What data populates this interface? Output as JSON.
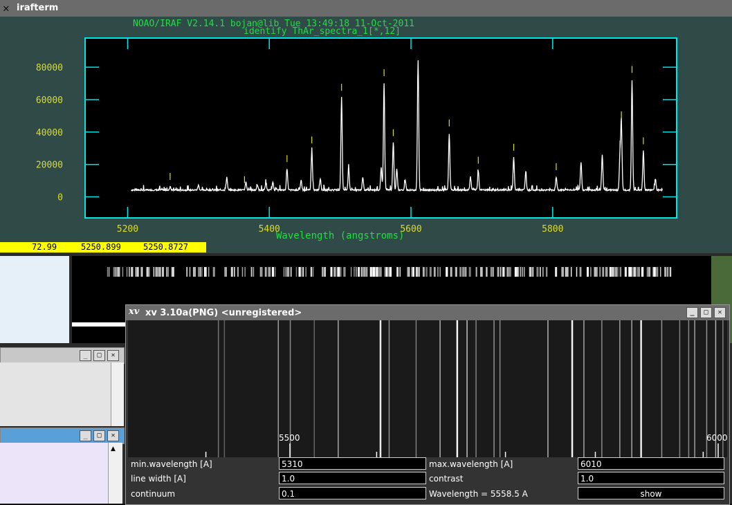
{
  "iraf_window": {
    "title": "irafterm",
    "header_line1": "NOAO/IRAF V2.14.1 bojan@lib Tue 13:49:18 11-Oct-2011",
    "header_line2": "identify ThAr_spectra_1[*,12]",
    "xlabel": "Wavelength (angstroms)",
    "status": {
      "v1": "72.99",
      "v2": "5250.899",
      "v3": "5250.8727"
    }
  },
  "chart_data": {
    "type": "line",
    "title": "",
    "xlabel": "Wavelength (angstroms)",
    "ylabel": "",
    "xlim": [
      5140,
      5975
    ],
    "ylim": [
      -13000,
      98000
    ],
    "x_ticks": [
      5200,
      5400,
      5600,
      5800
    ],
    "x_tick_labels": [
      "5200",
      "5400",
      "5600",
      "5800"
    ],
    "y_ticks": [
      0,
      20000,
      40000,
      60000,
      80000
    ],
    "y_tick_labels": [
      "0",
      "20000",
      "40000",
      "60000",
      "80000"
    ],
    "continuum_level": 4200,
    "colors": {
      "spectrum": "#ffffff",
      "axes": "#00e5e5",
      "tick_labels": "#dddd22",
      "markers": "#dddd22"
    },
    "series": [
      {
        "peaks": [
          [
            5260,
            2000
          ],
          [
            5300,
            3000
          ],
          [
            5340,
            8000
          ],
          [
            5367,
            5000
          ],
          [
            5383,
            3000
          ],
          [
            5395,
            4000
          ],
          [
            5405,
            4500
          ],
          [
            5425,
            13000
          ],
          [
            5445,
            6000
          ],
          [
            5460,
            24500
          ],
          [
            5472,
            7000
          ],
          [
            5502,
            57000
          ],
          [
            5512,
            14000
          ],
          [
            5532,
            8000
          ],
          [
            5558,
            14000
          ],
          [
            5562,
            66000
          ],
          [
            5575,
            29000
          ],
          [
            5580,
            13000
          ],
          [
            5592,
            6000
          ],
          [
            5610,
            80000
          ],
          [
            5654,
            35000
          ],
          [
            5684,
            8000
          ],
          [
            5695,
            12000
          ],
          [
            5745,
            20000
          ],
          [
            5762,
            11000
          ],
          [
            5805,
            8000
          ],
          [
            5840,
            17000
          ],
          [
            5870,
            22000
          ],
          [
            5895,
            22000
          ],
          [
            5897,
            40000
          ],
          [
            5912,
            68000
          ],
          [
            5928,
            24000
          ],
          [
            5945,
            7000
          ]
        ]
      }
    ],
    "identified_line_markers": [
      5260,
      5365,
      5425,
      5460,
      5502,
      5562,
      5575,
      5654,
      5695,
      5745,
      5805,
      5895,
      5897,
      5912,
      5928
    ]
  },
  "xv_window": {
    "title": "xv 3.10a(PNG) <unregistered>",
    "tick_labels": [
      "5500",
      "6000"
    ],
    "lines": [
      [
        0.25,
        0.5
      ],
      [
        0.27,
        0.4
      ],
      [
        0.35,
        0.55
      ],
      [
        0.42,
        0.9
      ],
      [
        0.435,
        0.45
      ],
      [
        0.48,
        0.35
      ],
      [
        0.52,
        0.6
      ],
      [
        0.548,
        0.95
      ],
      [
        0.565,
        0.7
      ],
      [
        0.61,
        0.45
      ],
      [
        0.62,
        0.4
      ],
      [
        0.7,
        0.6
      ],
      [
        0.76,
        0.55
      ],
      [
        0.79,
        0.4
      ],
      [
        0.82,
        0.5
      ],
      [
        0.84,
        0.55
      ],
      [
        0.89,
        0.45
      ],
      [
        0.92,
        0.35
      ],
      [
        0.935,
        0.4
      ],
      [
        0.945,
        0.5
      ],
      [
        0.965,
        0.45
      ],
      [
        0.98,
        0.6
      ],
      [
        0.992,
        0.35
      ],
      [
        0.15,
        0.3
      ],
      [
        0.16,
        0.2
      ],
      [
        0.31,
        0.2
      ],
      [
        0.58,
        0.35
      ],
      [
        0.74,
        0.95
      ],
      [
        0.855,
        0.9
      ]
    ],
    "form": {
      "min_wavelength_label": "min.wavelength [A]",
      "min_wavelength_value": "5310",
      "max_wavelength_label": "max.wavelength [A]",
      "max_wavelength_value": "6010",
      "line_width_label": "line width [A]",
      "line_width_value": "1.0",
      "contrast_label": "contrast",
      "contrast_value": "1.0",
      "continuum_label": "continuum",
      "continuum_value": "0.1",
      "wavelength_readout": "Wavelength = 5558.5 A",
      "show_button": "show"
    }
  }
}
